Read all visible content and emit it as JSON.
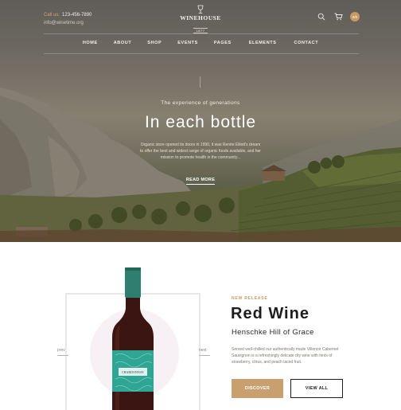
{
  "header": {
    "contact_label": "Call us:",
    "phone": "123-456-7890",
    "email": "info@winetime.org",
    "logo_name": "WINEHOUSE",
    "logo_year": "1877",
    "cart_count": "0/0"
  },
  "nav": {
    "items": [
      "HOME",
      "ABOUT",
      "SHOP",
      "EVENTS",
      "PAGES",
      "ELEMENTS",
      "CONTACT"
    ]
  },
  "hero": {
    "tagline": "The experience of generations",
    "headline": "In each bottle",
    "intro": "Organic store opened its doors in 1990, it was Renée Elliott's dream to offer the best and widest range of organic foods available, and her mission to promote health in the community...",
    "cta": "READ MORE"
  },
  "product": {
    "label": "NEW RELEASE",
    "title": "Red Wine",
    "subtitle": "Henschke Hill of Grace",
    "description": "Served well-chilled our authentically made Villenoir Cabernet Sauvignon is a refreshingly delicate dry wine with hints of strawberry, citrus, and peach laced fruit.",
    "bottle_label_text": "CHARDONNAY",
    "prev": "prev",
    "next": "next",
    "discover_label": "DISCOVER",
    "view_all_label": "VIEW ALL"
  },
  "colors": {
    "accent": "#c8a070",
    "bottle_label": "#2fa594",
    "dark": "#1d1d1d"
  }
}
